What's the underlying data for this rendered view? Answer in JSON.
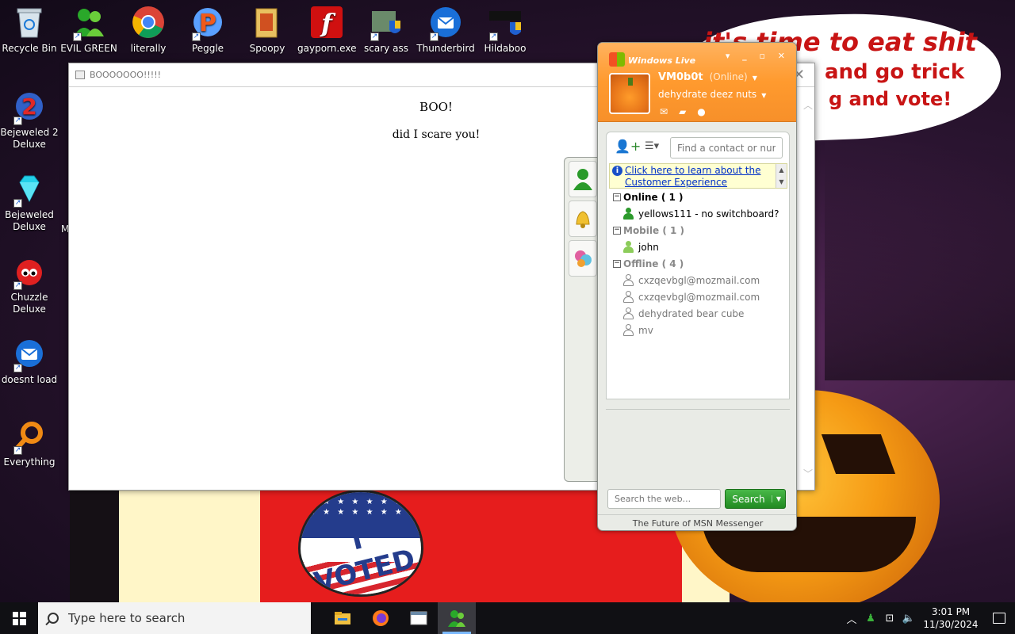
{
  "wallpaper": {
    "bubble_line1": "it's time to eat shit",
    "bubble_line2_a": "and",
    "bubble_line2_b": "go trick",
    "bubble_line3": "g and vote!",
    "sticker_text": "I VOTED"
  },
  "desktop_icons_left": [
    {
      "label": "Recycle Bin",
      "icon": "recycle-bin-icon"
    },
    {
      "label": "Bejeweled 2 Deluxe",
      "icon": "bejeweled-2-icon"
    },
    {
      "label": "Bejeweled Deluxe",
      "icon": "bejeweled-icon"
    },
    {
      "label": "Chuzzle Deluxe",
      "icon": "chuzzle-icon"
    },
    {
      "label": "doesnt load",
      "icon": "thunderbird-icon"
    },
    {
      "label": "Everything",
      "icon": "everything-search-icon"
    }
  ],
  "desktop_icons_top": [
    {
      "label": "EVIL GREEN MEN GO",
      "icon": "msn-buddies-icon"
    },
    {
      "label": "literally",
      "icon": "chrome-icon"
    },
    {
      "label": "Peggle Nights",
      "icon": "peggle-icon"
    },
    {
      "label": "Spoopy",
      "icon": "folder-icon"
    },
    {
      "label": "gayporn.exe",
      "icon": "flash-icon"
    },
    {
      "label": "scary ass",
      "icon": "installer-shield-icon"
    },
    {
      "label": "Thunderbird",
      "icon": "thunderbird-icon"
    },
    {
      "label": "Hildaboo",
      "icon": "yashma-shield-icon"
    }
  ],
  "partial_label": "M",
  "popup": {
    "title": "BOOOOOOO!!!!!",
    "heading": "BOO!",
    "paragraph": "did I scare you!"
  },
  "msn": {
    "brand": "Windows Live",
    "display_name": "VM0b0t",
    "status": "(Online)",
    "personal_message": "dehydrate deez nuts",
    "find_placeholder": "Find a contact or number...",
    "banner_link": "Click here to learn about the Customer Experience",
    "groups": {
      "online": {
        "label": "Online ( 1 )",
        "contacts": [
          "yellows111 - no switchboard?"
        ]
      },
      "mobile": {
        "label": "Mobile ( 1 )",
        "contacts": [
          "john"
        ]
      },
      "offline": {
        "label": "Offline ( 4 )",
        "contacts": [
          "cxzqevbgl@mozmail.com",
          "cxzqevbgl@mozmail.com",
          "dehydrated bear cube",
          "mv"
        ]
      }
    },
    "web_search_placeholder": "Search the web...",
    "search_button": "Search",
    "footer": "The Future of MSN Messenger"
  },
  "taskbar": {
    "search_placeholder": "Type here to search",
    "time": "3:01 PM",
    "date": "11/30/2024"
  },
  "colors": {
    "msn_orange": "#ff9a2e",
    "search_green": "#2a9a2a",
    "bubble_red": "#c81414"
  }
}
